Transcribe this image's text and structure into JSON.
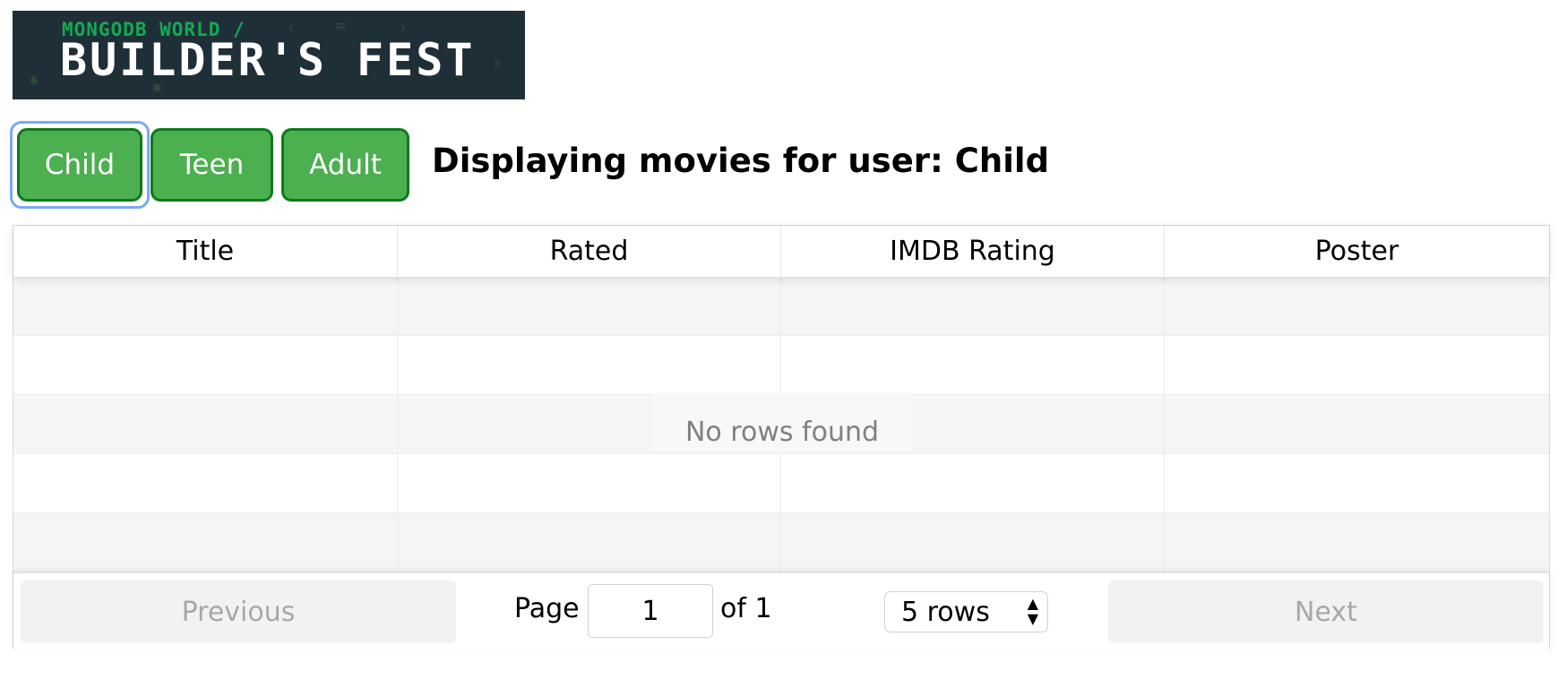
{
  "banner": {
    "subtitle": "MONGODB WORLD /",
    "title": "BUILDER'S FEST"
  },
  "users": {
    "buttons": [
      "Child",
      "Teen",
      "Adult"
    ],
    "focused": "Child"
  },
  "heading": "Displaying movies for user: Child",
  "table": {
    "columns": [
      "Title",
      "Rated",
      "IMDB Rating",
      "Poster"
    ],
    "empty_message": "No rows found",
    "rows": []
  },
  "pagination": {
    "previous_label": "Previous",
    "next_label": "Next",
    "page_label": "Page",
    "page_value": "1",
    "of_label": "of 1",
    "rows_select": "5 rows"
  },
  "colors": {
    "button_green": "#4caf50",
    "button_border": "#0f7a1a",
    "focus_ring": "#7aa8f7",
    "banner_bg": "#1f2f38",
    "banner_accent": "#13aa52"
  }
}
